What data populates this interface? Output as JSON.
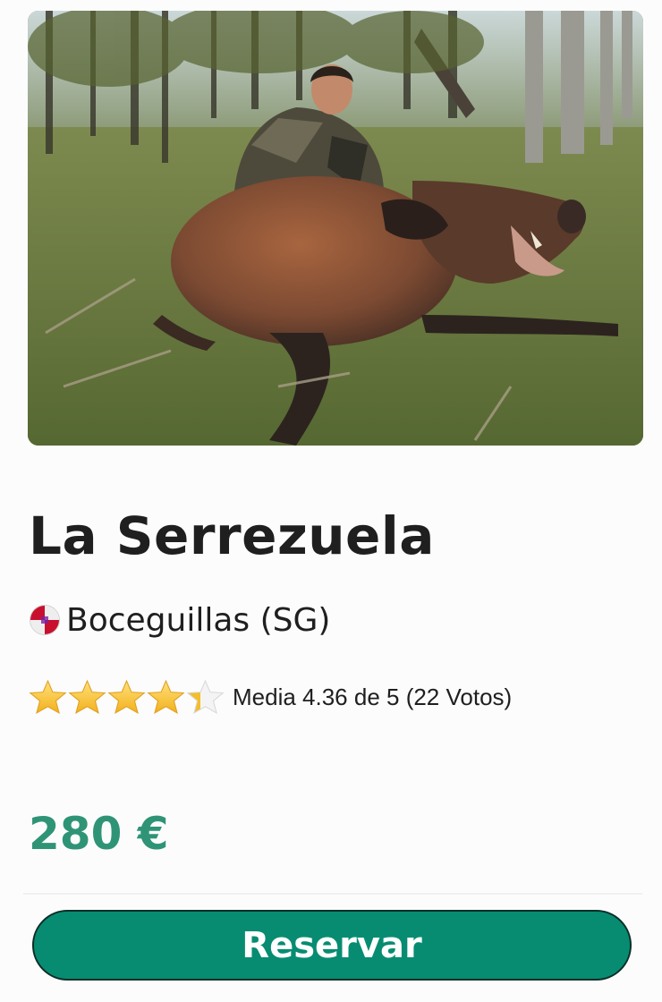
{
  "listing": {
    "photo_icon": "hunting-photo-wild-boar",
    "name": "La Serrezuela",
    "location": "Boceguillas (SG)",
    "location_icon": "segovia-flag-icon",
    "rating": {
      "stars_filled": 4.36,
      "stars_total": 5,
      "text": "Media 4.36 de 5 (22 Votos)"
    },
    "price": "280 €",
    "reserve_label": "Reservar"
  },
  "colors": {
    "price": "#2f9475",
    "button_bg": "#078c72",
    "button_border": "#0c2e28",
    "star": "#f5c518"
  }
}
